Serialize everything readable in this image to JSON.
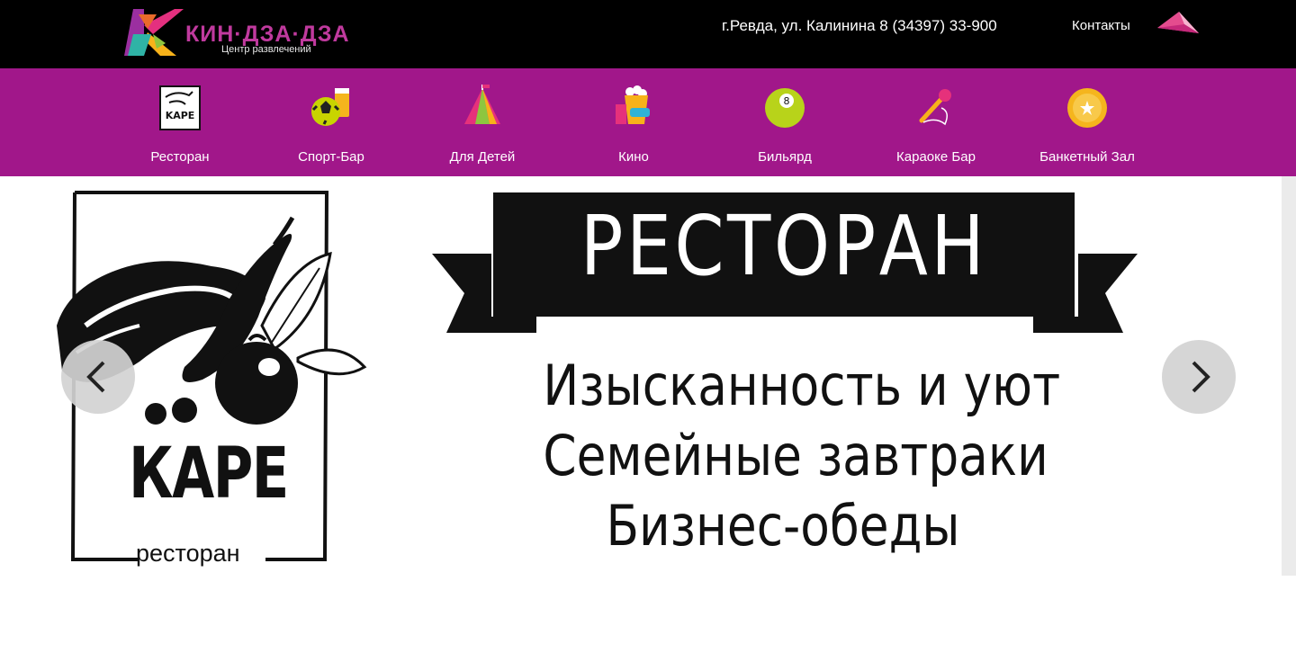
{
  "header": {
    "logo_name": "КИН·ДЗА·ДЗА",
    "logo_sub": "Центр развлечений",
    "address": "г.Ревда, ул. Калинина  8 (34397) 33-900",
    "contacts_label": "Контакты"
  },
  "nav": {
    "items": [
      {
        "label": "Ресторан",
        "icon": "restaurant-icon"
      },
      {
        "label": "Спорт-Бар",
        "icon": "sport-bar-icon"
      },
      {
        "label": "Для Детей",
        "icon": "kids-tent-icon"
      },
      {
        "label": "Кино",
        "icon": "cinema-popcorn-icon"
      },
      {
        "label": "Бильярд",
        "icon": "billiard-ball-icon"
      },
      {
        "label": "Караоке Бар",
        "icon": "karaoke-microphone-icon"
      },
      {
        "label": "Банкетный Зал",
        "icon": "banquet-badge-icon"
      }
    ]
  },
  "slide": {
    "kare_title": "КАРЕ",
    "kare_sub": "ресторан",
    "ribbon_title": "РЕСТОРАН",
    "taglines": [
      "Изысканность и уют",
      "Семейные завтраки",
      "Бизнес-обеды"
    ]
  },
  "colors": {
    "topbar": "#000000",
    "nav": "#a1178a",
    "logo_text": "#c03a9e",
    "arrow_bg": "#d2d2d2"
  }
}
